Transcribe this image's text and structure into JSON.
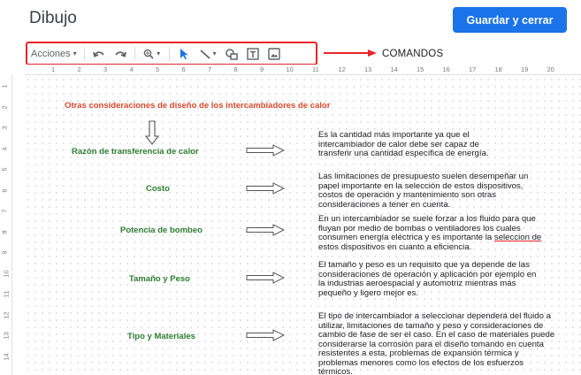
{
  "header": {
    "title": "Dibujo",
    "save_button": "Guardar y cerrar"
  },
  "toolbar": {
    "actions_label": "Acciones",
    "actions_chevron": "▾",
    "zoom_chevron": "▾",
    "line_chevron": "▾",
    "icons": [
      "undo-icon",
      "redo-icon",
      "zoom-icon",
      "select-icon",
      "line-icon",
      "shape-icon",
      "textbox-icon",
      "image-icon"
    ]
  },
  "annotation": {
    "label": "COMANDOS",
    "color": "#e8232a"
  },
  "ruler": {
    "top_marks": [
      "1",
      "2",
      "3",
      "4",
      "5",
      "6",
      "7",
      "8",
      "9",
      "10",
      "11",
      "12",
      "13",
      "14",
      "15",
      "16",
      "17",
      "18",
      "19",
      "20"
    ],
    "left_marks": [
      "1",
      "2",
      "3",
      "4",
      "5",
      "6",
      "7",
      "8",
      "9",
      "10",
      "11",
      "12",
      "13",
      "14"
    ]
  },
  "drawing": {
    "heading": "Otras consideraciones de diseño de los intercambiadores de calor",
    "rows": [
      {
        "label": "Razón de transferencia de calor",
        "lines": [
          "Es la cantidad más importante ya que el",
          "intercambiador de calor debe ser capaz de",
          "transferir una cantidad específica de energía."
        ]
      },
      {
        "label": "Costo",
        "lines": [
          "Las limitaciones de presupuesto suelen desempeñar un",
          "papel importante en la selección de estos dispositivos,",
          "costos de operación y mantenimiento son otras",
          "consideraciones a tener en cuenta."
        ]
      },
      {
        "label": "Potencia de bombeo",
        "lines": [
          "En un intercambiador se suele forzar  a los fluido para que",
          "fluyan por medio de bombas o ventiladores los cuales",
          "consumen energía eléctrica y es importante la",
          "estos dispositivos en cuanto a eficiencia."
        ],
        "underlined": "seleccion de"
      },
      {
        "label": "Tamaño y Peso",
        "lines": [
          "El tamaño y peso es un requisito que ya depende de las",
          "consideraciones de operación y aplicación por ejemplo en",
          "la industrias aeroespacial y automotriz mientras más",
          "pequeño y ligero mejor es."
        ]
      },
      {
        "label": "Tipo y Materiales",
        "lines": [
          "El tipo de intercambiador a seleccionar dependerá del fluido a",
          "utilizar, limitaciones de tamaño y peso y consideraciones de",
          "cambio de fase de ser el caso. En el caso de materiales puede",
          "considerarse la corrosión para el diseño tomando en cuenta",
          "resistentes a esta, problemas de expansión térmica y",
          "problemas menores como los efectos de los esfuerzos",
          "térmicos."
        ]
      }
    ]
  }
}
